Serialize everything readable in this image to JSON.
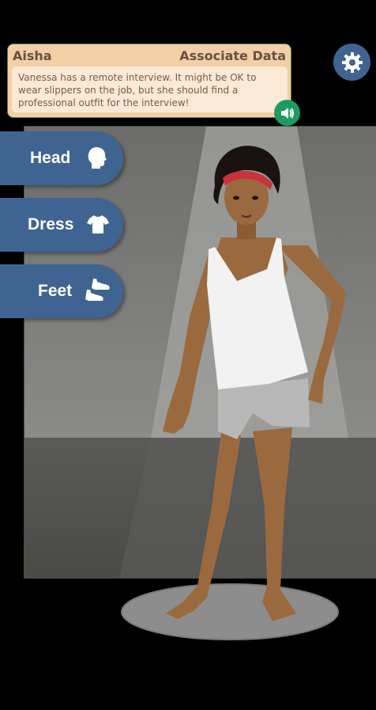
{
  "dialog": {
    "speaker_name": "Aisha",
    "speaker_role": "Associate Data",
    "message": "Vanessa has a remote interview. It might be OK to wear slippers on the job, but she should find a professional outfit for the interview!"
  },
  "categories": [
    {
      "label": "Head",
      "icon": "head-icon"
    },
    {
      "label": "Dress",
      "icon": "shirt-icon"
    },
    {
      "label": "Feet",
      "icon": "shoes-icon"
    }
  ],
  "colors": {
    "button_blue": "#3f6491",
    "speaker_green": "#1f9a62",
    "dialog_bg": "#f3cfa6",
    "skin": "#9a6a3e",
    "headband": "#c8323a"
  },
  "icons": {
    "settings": "gear-icon",
    "audio": "speaker-icon"
  }
}
